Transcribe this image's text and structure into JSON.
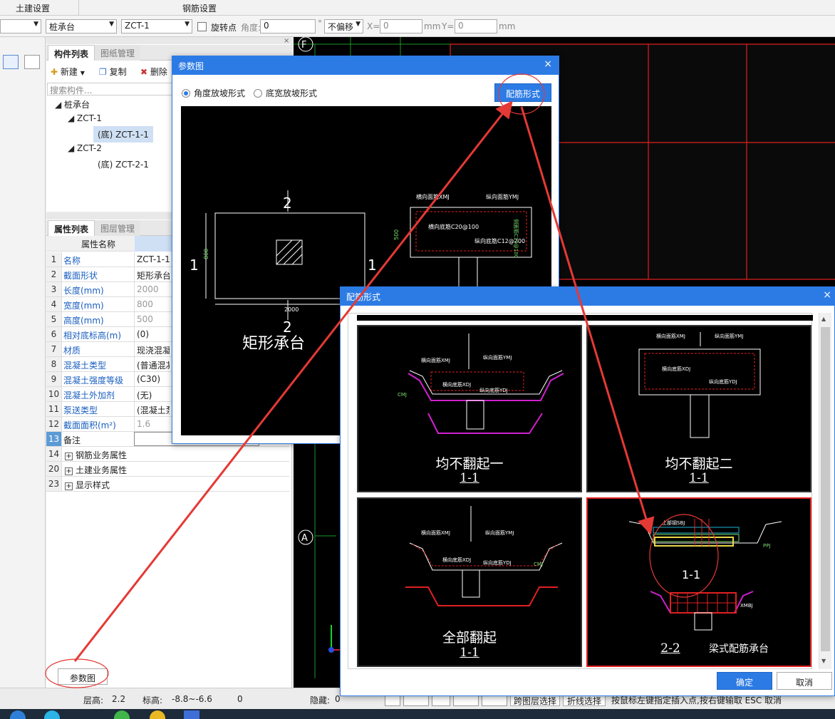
{
  "menu": {
    "civil_settings": "土建设置",
    "rebar_settings": "钢筋设置"
  },
  "toolbar": {
    "component_type": "桩承台",
    "component_name": "ZCT-1",
    "rotate_point": "旋转点",
    "angle_label": "角度:",
    "angle_value": "0",
    "degree_unit": "°",
    "offset_mode": "不偏移",
    "x_label": "X=",
    "x_value": "0",
    "mm1": "mm",
    "y_label": "Y=",
    "y_value": "0",
    "mm2": "mm"
  },
  "component_panel": {
    "tab_list": "构件列表",
    "tab_drawing": "图纸管理",
    "new_label": "新建",
    "copy_label": "复制",
    "delete_label": "删除",
    "search_placeholder": "搜索构件...",
    "tree": {
      "root": "桩承台",
      "g1": "ZCT-1",
      "g1c": "(底) ZCT-1-1",
      "g2": "ZCT-2",
      "g2c": "(底) ZCT-2-1"
    }
  },
  "props_panel": {
    "tab_props": "属性列表",
    "tab_layers": "图层管理",
    "col_name": "属性名称",
    "rows": [
      {
        "n": "1",
        "k": "名称",
        "v": "ZCT-1-1",
        "kc": "k",
        "vc": "v"
      },
      {
        "n": "2",
        "k": "截面形状",
        "v": "矩形承台",
        "kc": "k",
        "vc": "v"
      },
      {
        "n": "3",
        "k": "长度(mm)",
        "v": "2000",
        "kc": "k",
        "vc": "v g"
      },
      {
        "n": "4",
        "k": "宽度(mm)",
        "v": "800",
        "kc": "k",
        "vc": "v g"
      },
      {
        "n": "5",
        "k": "高度(mm)",
        "v": "500",
        "kc": "k",
        "vc": "v g"
      },
      {
        "n": "6",
        "k": "相对底标高(m)",
        "v": "(0)",
        "kc": "k",
        "vc": "v"
      },
      {
        "n": "7",
        "k": "材质",
        "v": "现浇混凝",
        "kc": "k",
        "vc": "v"
      },
      {
        "n": "8",
        "k": "混凝土类型",
        "v": "(普通混凝",
        "kc": "k",
        "vc": "v"
      },
      {
        "n": "9",
        "k": "混凝土强度等级",
        "v": "(C30)",
        "kc": "k",
        "vc": "v"
      },
      {
        "n": "10",
        "k": "混凝土外加剂",
        "v": "(无)",
        "kc": "k",
        "vc": "v"
      },
      {
        "n": "11",
        "k": "泵送类型",
        "v": "(混凝土泵",
        "kc": "k",
        "vc": "v"
      },
      {
        "n": "12",
        "k": "截面面积(m²)",
        "v": "1.6",
        "kc": "k",
        "vc": "v g"
      },
      {
        "n": "13",
        "k": "备注",
        "v": "",
        "kc": "k blk",
        "vc": "v"
      }
    ],
    "group_rows": [
      {
        "n": "14",
        "k": "钢筋业务属性"
      },
      {
        "n": "20",
        "k": "土建业务属性"
      },
      {
        "n": "23",
        "k": "显示样式"
      }
    ],
    "param_button": "参数图"
  },
  "param_dialog": {
    "title": "参数图",
    "close": "×",
    "radio_angle": "角度放坡形式",
    "radio_width": "底宽放坡形式",
    "rebar_button": "配筋形式",
    "drawing": {
      "title": "矩形承台",
      "sec1": "1",
      "sec2": "2",
      "dim_w": "2000",
      "dim_h": "800",
      "dim_d": "500",
      "lbl_top_x": "横向面筋XMJ",
      "lbl_top_y": "纵向面筋YMJ",
      "lbl_bot_x": "横向底筋C20@100",
      "lbl_bot_y": "纵向底筋C12@200",
      "lbl_side": "侧面筋C10@100"
    }
  },
  "rebar_dialog": {
    "title": "配筋形式",
    "close": "×",
    "ok": "确定",
    "cancel": "取消",
    "options": [
      {
        "name": "均不翻起一",
        "section": "1-1"
      },
      {
        "name": "均不翻起二",
        "section": "1-1"
      },
      {
        "name": "全部翻起",
        "section": "1-1"
      },
      {
        "name": "梁式配筋承台",
        "section": "1-1",
        "section2": "2-2"
      }
    ],
    "labels": {
      "xmj": "横向面筋XMJ",
      "ymj": "纵向面筋YMJ",
      "xdj": "横向底筋XDJ",
      "ydj": "纵向底筋YDJ",
      "cmj": "CMJ",
      "sbj": "上部钢SBJ",
      "ppj": "PPJ",
      "xmbj": "XMBJ"
    }
  },
  "canvas": {
    "axis_f": "F",
    "axis_a": "A"
  },
  "statusbar": {
    "floor_height": "层高:",
    "floor_height_v": "2.2",
    "elev": "标高:",
    "elev_v": "-8.8~-6.6",
    "zero": "0",
    "hidden": "隐藏:",
    "hidden_v": "0",
    "cross_layer": "跨图层选择",
    "polyline_select": "折线选择",
    "hint": "按鼠标左键指定插入点,按右键输取 ESC 取消"
  },
  "colors": {
    "accent": "#2c7be5",
    "annotation": "#e53935",
    "cad_bg": "#000000"
  }
}
